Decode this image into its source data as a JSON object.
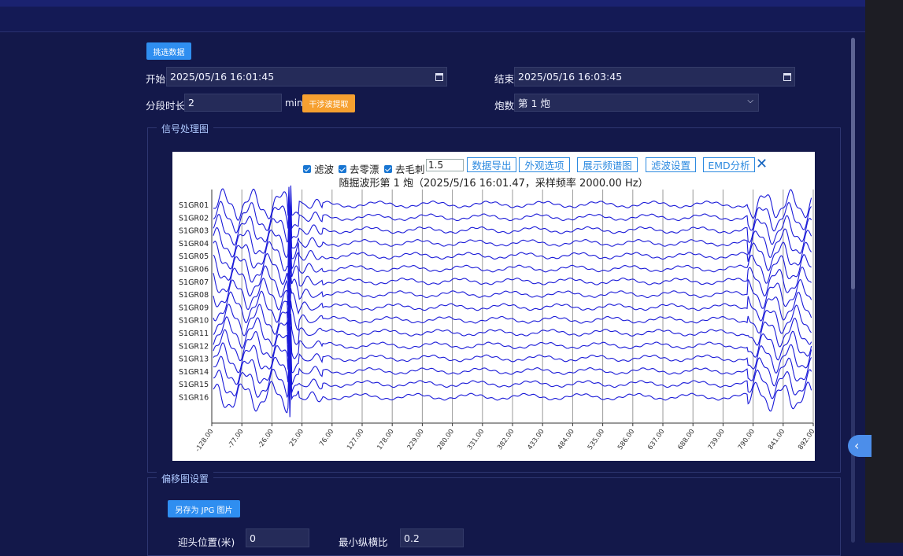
{
  "header": {
    "select_data_button": "挑选数据"
  },
  "form": {
    "start_label": "开始",
    "start_value": "2025/05/16  16:01:45",
    "end_label": "结束",
    "end_value": "2025/05/16  16:03:45",
    "segment_label": "分段时长",
    "segment_value": "2",
    "segment_unit": "min",
    "interference_button": "干涉波提取",
    "shot_label": "炮数",
    "shot_value": "第 1 炮"
  },
  "signal_section": {
    "legend": "信号处理图",
    "toolbar": {
      "filter_label": "滤波",
      "dezero_label": "去零漂",
      "despike_label": "去毛刺",
      "despike_value": "1.5",
      "export_button": "数据导出",
      "appearance_button": "外观选项",
      "spectrum_button": "展示频谱图",
      "filter_settings_button": "滤波设置",
      "emd_button": "EMD分析"
    },
    "chart_title": "随掘波形第 1 炮（2025/5/16 16:01.47，采样频率 2000.00 Hz）"
  },
  "offset_section": {
    "legend": "偏移图设置",
    "save_jpg_button": "另存为 JPG 图片",
    "head_position_label": "迎头位置(米)",
    "head_position_value": "0",
    "min_ratio_label": "最小纵横比",
    "min_ratio_value": "0.2"
  },
  "colors": {
    "accent": "#2f8ef0",
    "orange": "#f6a030",
    "wave": "#1a1ad8",
    "background": "#13184a"
  },
  "icons": {
    "calendar": "calendar-icon",
    "dropdown": "chevron-down-icon",
    "close": "close-icon",
    "collapse": "chevron-left-icon"
  },
  "chart_data": {
    "type": "line",
    "series": [
      {
        "name": "S1GR01"
      },
      {
        "name": "S1GR02"
      },
      {
        "name": "S1GR03"
      },
      {
        "name": "S1GR04"
      },
      {
        "name": "S1GR05"
      },
      {
        "name": "S1GR06"
      },
      {
        "name": "S1GR07"
      },
      {
        "name": "S1GR08"
      },
      {
        "name": "S1GR09"
      },
      {
        "name": "S1GR10"
      },
      {
        "name": "S1GR11"
      },
      {
        "name": "S1GR12"
      },
      {
        "name": "S1GR13"
      },
      {
        "name": "S1GR14"
      },
      {
        "name": "S1GR15"
      },
      {
        "name": "S1GR16"
      }
    ],
    "x_ticks": [
      "-128.00",
      "-77.00",
      "-26.00",
      "25.00",
      "76.00",
      "127.00",
      "178.00",
      "229.00",
      "280.00",
      "331.00",
      "382.00",
      "433.00",
      "484.00",
      "535.00",
      "586.00",
      "637.00",
      "688.00",
      "739.00",
      "790.00",
      "841.00",
      "892.00"
    ],
    "xlim": [
      -128,
      892
    ],
    "grid": true,
    "legend": "left"
  }
}
